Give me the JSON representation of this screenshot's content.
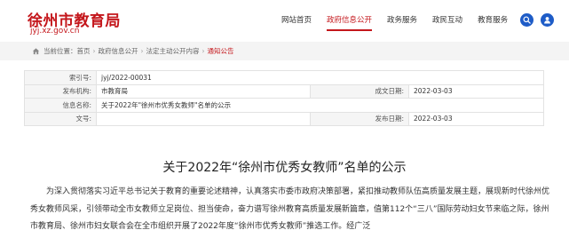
{
  "site": {
    "title": "徐州市教育局",
    "subtitle": "jyj.xz.gov.cn"
  },
  "nav": {
    "items": [
      {
        "label": "网站首页",
        "active": false
      },
      {
        "label": "政府信息公开",
        "active": true
      },
      {
        "label": "政务服务",
        "active": false
      },
      {
        "label": "政民互动",
        "active": false
      },
      {
        "label": "教育服务",
        "active": false
      }
    ]
  },
  "icons": {
    "search": "search-icon",
    "user": "user-icon",
    "home": "home-icon",
    "accent": "#c4171c",
    "button": "#1e5cc7"
  },
  "breadcrumb": {
    "prefix": "当前位置：",
    "items": [
      "首页",
      "政府信息公开",
      "法定主动公开内容"
    ],
    "current": "通知公告"
  },
  "info": {
    "index_label": "索引号:",
    "index_value": "jyj/2022-00031",
    "publisher_label": "发布机构:",
    "publisher_value": "市教育局",
    "created_label": "成文日期:",
    "created_value": "2022-03-03",
    "name_label": "信息名称:",
    "name_value": "关于2022年\"徐州市优秀女教师\"名单的公示",
    "docno_label": "文号:",
    "docno_value": "",
    "published_label": "发布日期:",
    "published_value": "2022-03-03"
  },
  "article": {
    "title": "关于2022年“徐州市优秀女教师”名单的公示",
    "body": "为深入贯彻落实习近平总书记关于教育的重要论述精神，认真落实市委市政府决策部署，紧扣推动教师队伍高质量发展主题，展现新时代徐州优秀女教师风采，引领带动全市女教师立足岗位、担当使命，奋力谱写徐州教育高质量发展新篇章，值第112个“三八”国际劳动妇女节来临之际，徐州市教育局、徐州市妇女联合会在全市组织开展了2022年度“徐州市优秀女教师”推选工作。经广泛"
  }
}
